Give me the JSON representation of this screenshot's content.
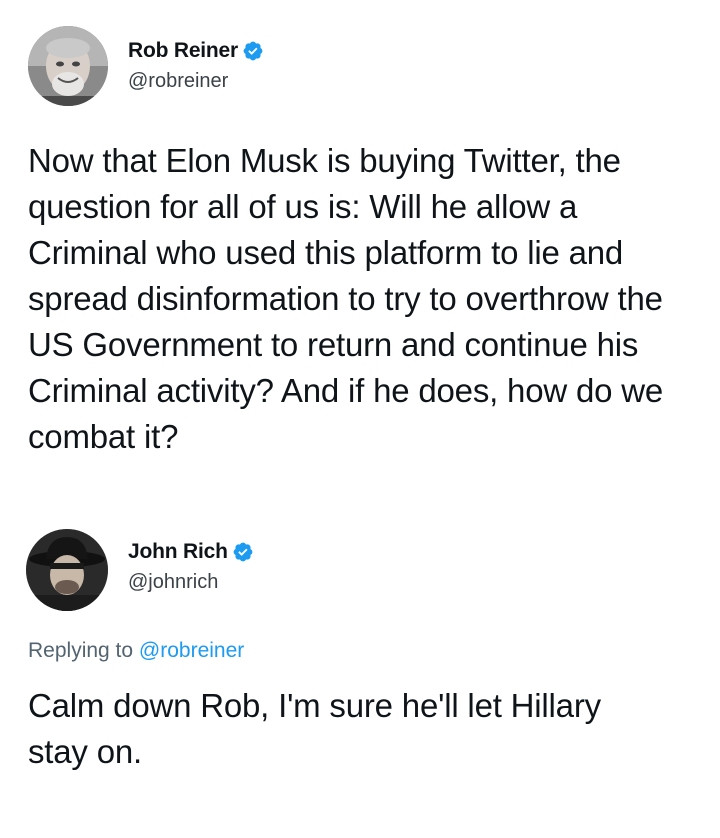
{
  "tweets": [
    {
      "author": {
        "display_name": "Rob Reiner",
        "handle": "@robreiner",
        "verified": true,
        "avatar_icon": "avatar-photo-gray-haired-man"
      },
      "text": "Now that Elon Musk is buying Twitter, the question for all of us is: Will he allow a Criminal who used this platform to lie and spread disinformation to try to overthrow the US Government to return and continue his Criminal activity? And if he does, how do we combat it?"
    },
    {
      "author": {
        "display_name": "John Rich",
        "handle": "@johnrich",
        "verified": true,
        "avatar_icon": "avatar-photo-man-cowboy-hat"
      },
      "replying_prefix": "Replying to",
      "replying_to": "@robreiner",
      "text": "Calm down Rob, I'm sure he'll let Hillary stay on."
    }
  ],
  "colors": {
    "verified_blue": "#1d9bf0",
    "text": "#0f1419",
    "secondary_text": "#536471",
    "background": "#ffffff"
  }
}
